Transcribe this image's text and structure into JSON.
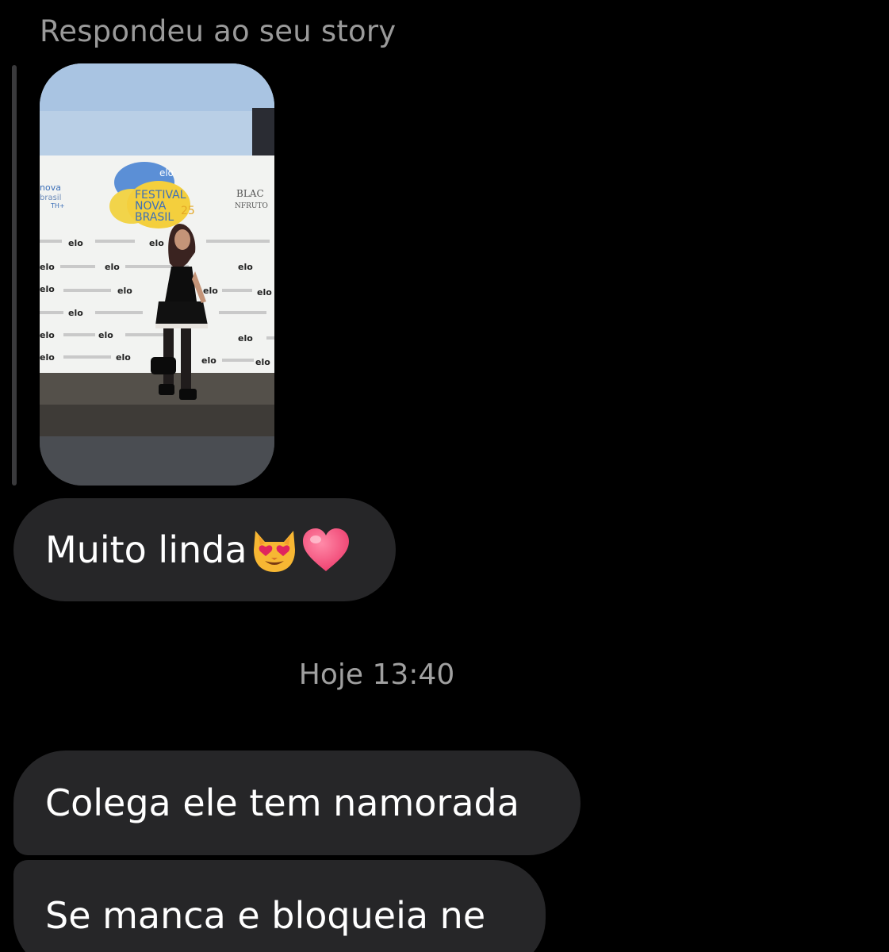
{
  "header": {
    "story_reply_label": "Respondeu ao seu story"
  },
  "story": {
    "backdrop_top_line": "elo",
    "festival_line_1": "FESTIVAL",
    "festival_line_2": "NOVA",
    "festival_line_3": "BRASIL",
    "festival_year": "25",
    "side_logo_line_1": "nova",
    "side_logo_line_2": "brasil",
    "side_logo_line_3": "TH+",
    "right_logo_line_1": "BLAC",
    "right_logo_line_2": "NFRUTO",
    "sponsor_word": "elo"
  },
  "messages": [
    {
      "text": "Muito linda",
      "emojis": [
        "smiling-cat-heart-eyes",
        "heart"
      ]
    },
    {
      "text": "Colega ele tem namorada"
    },
    {
      "text": "Se manca e bloqueia ne"
    }
  ],
  "timestamp": "Hoje 13:40",
  "colors": {
    "background": "#000000",
    "bubble": "#262628",
    "meta_text": "#9a9a9a"
  }
}
